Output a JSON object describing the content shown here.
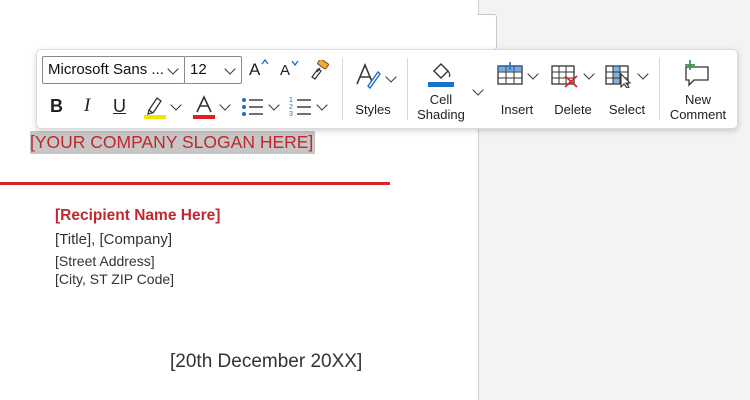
{
  "document": {
    "slogan": "[YOUR COMPANY SLOGAN HERE]",
    "recipient_name": "[Recipient Name Here]",
    "title_company": "[Title], [Company]",
    "street": "[Street Address]",
    "city": "[City, ST ZIP Code]",
    "date": "[20th December 20XX]"
  },
  "toolbar": {
    "font_name": "Microsoft Sans ...",
    "font_size": "12",
    "bold_label": "B",
    "italic_label": "I",
    "underline_label": "U",
    "grow_font_label": "A",
    "shrink_font_label": "A",
    "styles_label": "Styles",
    "cell_shading_label_1": "Cell",
    "cell_shading_label_2": "Shading",
    "insert_label": "Insert",
    "delete_label": "Delete",
    "select_label": "Select",
    "new_comment_label_1": "New",
    "new_comment_label_2": "Comment"
  },
  "colors": {
    "accent_red": "#d5262b",
    "highlight_yellow": "#f2e600",
    "font_color_red": "#e01e1e",
    "shading_blue": "#1a73c8"
  }
}
